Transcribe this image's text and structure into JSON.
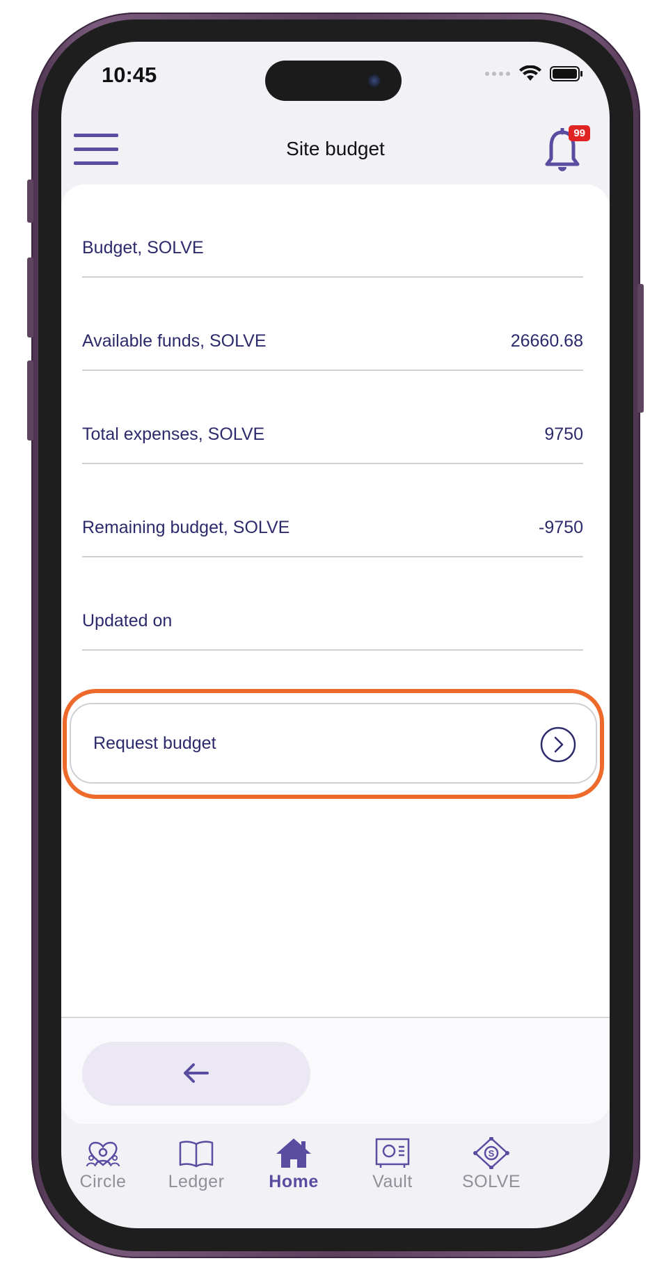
{
  "status_bar": {
    "time": "10:45"
  },
  "header": {
    "title": "Site budget",
    "notification_count": "99"
  },
  "budget_rows": [
    {
      "label": "Budget, SOLVE",
      "value": ""
    },
    {
      "label": "Available funds, SOLVE",
      "value": "26660.68"
    },
    {
      "label": "Total expenses, SOLVE",
      "value": "9750"
    },
    {
      "label": "Remaining budget, SOLVE",
      "value": "-9750"
    },
    {
      "label": "Updated on",
      "value": ""
    }
  ],
  "request_budget": {
    "label": "Request budget"
  },
  "tabs": [
    {
      "label": "Circle",
      "icon": "circle-people-icon",
      "active": false
    },
    {
      "label": "Ledger",
      "icon": "book-icon",
      "active": false
    },
    {
      "label": "Home",
      "icon": "home-icon",
      "active": true
    },
    {
      "label": "Vault",
      "icon": "vault-icon",
      "active": false
    },
    {
      "label": "SOLVE",
      "icon": "solve-token-icon",
      "active": false
    }
  ],
  "colors": {
    "accent": "#5a4ca0",
    "text": "#2c2a6b",
    "highlight": "#ee6a2a",
    "badge": "#e02424",
    "inactive": "#8f8f98"
  }
}
